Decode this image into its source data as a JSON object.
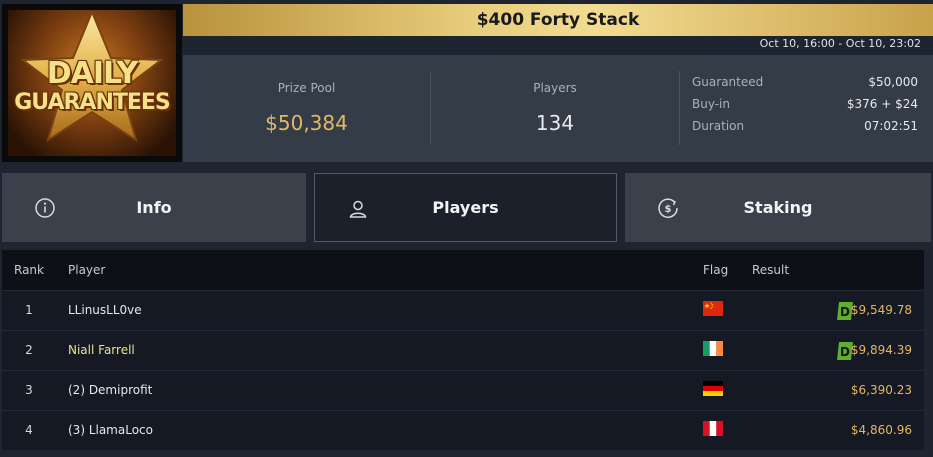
{
  "logo": {
    "line1": "DAILY",
    "line2": "GUARANTEES"
  },
  "tournament": {
    "title": "$400 Forty Stack",
    "date_range": "Oct 10, 16:00 - Oct 10, 23:02"
  },
  "stats": {
    "prize_pool_label": "Prize Pool",
    "prize_pool_value": "$50,384",
    "players_label": "Players",
    "players_value": "134",
    "details": [
      {
        "label": "Guaranteed",
        "value": "$50,000"
      },
      {
        "label": "Buy-in",
        "value": "$376 + $24"
      },
      {
        "label": "Duration",
        "value": "07:02:51"
      }
    ]
  },
  "tabs": [
    {
      "label": "Info",
      "icon": "info-icon"
    },
    {
      "label": "Players",
      "icon": "user-icon",
      "active": true
    },
    {
      "label": "Staking",
      "icon": "dollar-coin-icon"
    }
  ],
  "table": {
    "headers": {
      "rank": "Rank",
      "player": "Player",
      "flag": "Flag",
      "result": "Result"
    },
    "rows": [
      {
        "rank": "1",
        "player": "LLinusLL0ve",
        "flag": "china-flag",
        "result": "$9,549.78",
        "badge": "D",
        "highlight": false
      },
      {
        "rank": "2",
        "player": "Niall Farrell",
        "flag": "ireland-flag",
        "result": "$9,894.39",
        "badge": "D",
        "highlight": true
      },
      {
        "rank": "3",
        "player": "(2) Demiprofit",
        "flag": "germany-flag",
        "result": "$6,390.23",
        "badge": "",
        "highlight": false
      },
      {
        "rank": "4",
        "player": "(3) LlamaLoco",
        "flag": "peru-flag",
        "result": "$4,860.96",
        "badge": "",
        "highlight": false
      }
    ]
  },
  "colors": {
    "accent_gold": "#e2b865",
    "highlight_name": "#e7e38a",
    "badge_green": "#5fae2e"
  }
}
